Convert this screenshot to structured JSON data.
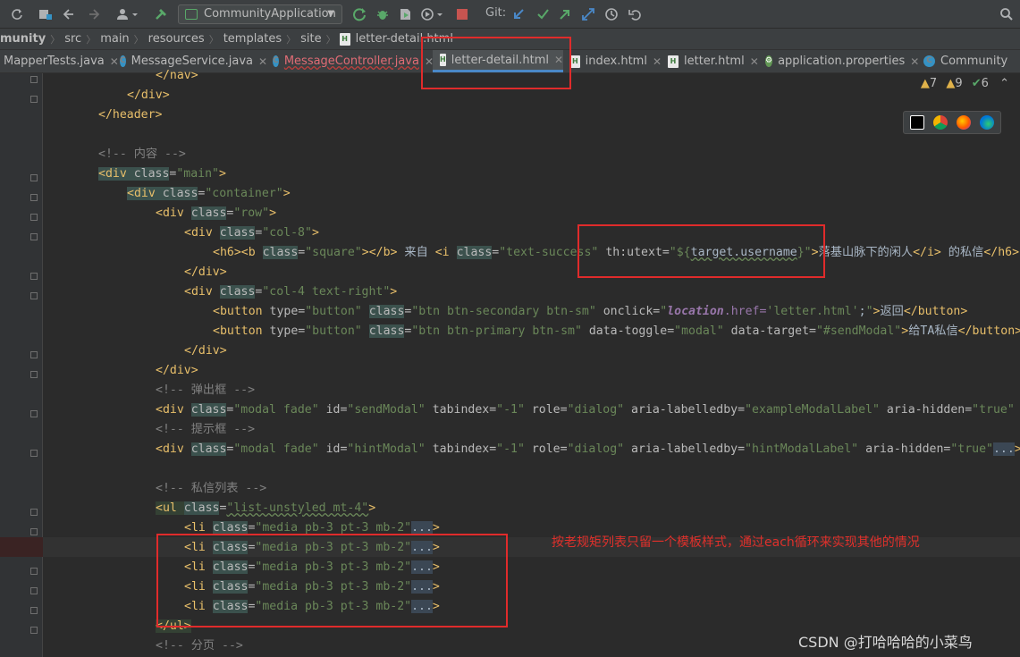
{
  "toolbar": {
    "run_config": "CommunityApplication",
    "git_label": "Git:"
  },
  "breadcrumb": [
    "munity",
    "src",
    "main",
    "resources",
    "templates",
    "site",
    "letter-detail.html"
  ],
  "tabs": [
    {
      "label": "MapperTests.java",
      "type": "java"
    },
    {
      "label": "MessageService.java",
      "type": "java"
    },
    {
      "label": "MessageController.java",
      "type": "java"
    },
    {
      "label": "letter-detail.html",
      "type": "html"
    },
    {
      "label": "index.html",
      "type": "html"
    },
    {
      "label": "letter.html",
      "type": "html"
    },
    {
      "label": "application.properties",
      "type": "properties"
    },
    {
      "label": "Community",
      "type": "java"
    }
  ],
  "inspections": {
    "warnings": "7",
    "weak_warnings": "9",
    "typos": "6"
  },
  "code": {
    "l0": "</nav>",
    "l1": "</div>",
    "l2": "</header>",
    "l4": "<!-- 内容 -->",
    "l5_tag": "<div ",
    "l5_attr": "class",
    "l5_val": "\"main\"",
    "l6_tag": "<div ",
    "l6_attr": "class",
    "l6_val": "\"container\"",
    "l7_tag": "<div ",
    "l7_attr": "class",
    "l7_val": "\"row\"",
    "l8_tag": "<div ",
    "l8_attr": "class",
    "l8_val": "\"col-8\"",
    "l9_text1": " 来自 ",
    "l9_username": "target.username",
    "l9_text2": "落基山脉下的闲人",
    "l9_text3": " 的私信",
    "l10": "</div>",
    "l11_tag": "<div ",
    "l11_attr": "class",
    "l11_val": "\"col-4 text-right\"",
    "l12_onclick": "location",
    "l12_href": ".href=",
    "l12_url": "'letter.html'",
    "l12_label": "返回",
    "l13_target": "\"#sendModal\"",
    "l13_label": "给TA私信",
    "l14": "</div>",
    "l15": "</div>",
    "l16": "<!-- 弹出框 -->",
    "l17_id": "\"sendModal\"",
    "l17_labelled": "\"exampleModalLabel\"",
    "l18": "<!-- 提示框 -->",
    "l19_id": "\"hintModal\"",
    "l19_labelled": "\"hintModalLabel\"",
    "l21": "<!-- 私信列表 -->",
    "l22_val": "\"list-unstyled mt-4\"",
    "li_val": "\"media pb-3 pt-3 mb-2\"",
    "l28": "</ul>",
    "l29": "<!-- 分页 -->"
  },
  "annotation": "按老规矩列表只留一个模板样式，通过each循环来实现其他的情况",
  "watermark": "CSDN @打哈哈哈的小菜鸟"
}
